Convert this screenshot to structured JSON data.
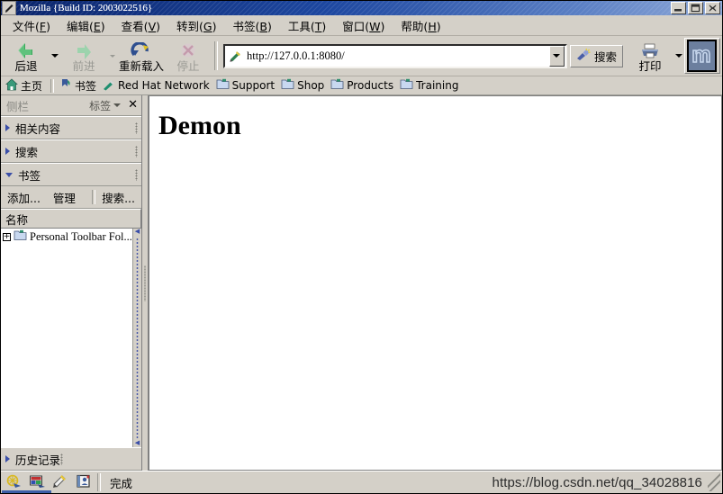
{
  "window": {
    "title": "Mozilla {Build ID: 2003022516}",
    "icon": "mozilla-window-icon",
    "controls": [
      {
        "name": "minimize-button",
        "glyph": "minimize-icon"
      },
      {
        "name": "maximize-button",
        "glyph": "maximize-icon"
      },
      {
        "name": "close-button",
        "glyph": "close-icon"
      }
    ]
  },
  "menubar": {
    "items": [
      {
        "label": "文件(F)",
        "text": "文件",
        "accel": "F"
      },
      {
        "label": "编辑(E)",
        "text": "编辑",
        "accel": "E"
      },
      {
        "label": "查看(V)",
        "text": "查看",
        "accel": "V"
      },
      {
        "label": "转到(G)",
        "text": "转到",
        "accel": "G"
      },
      {
        "label": "书签(B)",
        "text": "书签",
        "accel": "B"
      },
      {
        "label": "工具(T)",
        "text": "工具",
        "accel": "T"
      },
      {
        "label": "窗口(W)",
        "text": "窗口",
        "accel": "W"
      },
      {
        "label": "帮助(H)",
        "text": "帮助",
        "accel": "H"
      }
    ]
  },
  "toolbar": {
    "back_label": "后退",
    "forward_label": "前进",
    "reload_label": "重新载入",
    "stop_label": "停止",
    "search_label": "搜索",
    "print_label": "打印",
    "back_enabled": true,
    "forward_enabled": false,
    "stop_enabled": false,
    "logo": "mozilla-throbber-logo"
  },
  "urlbar": {
    "value": "http://127.0.0.1:8080/",
    "placeholder": "",
    "favicon": "mozilla-page-icon"
  },
  "bookmarks_bar": {
    "items": [
      {
        "label": "主页",
        "icon": "home-icon"
      },
      {
        "label": "书签",
        "icon": "bookmark-icon"
      },
      {
        "label": "Red Hat Network",
        "icon": "redhat-icon"
      },
      {
        "label": "Support",
        "icon": "folder-icon"
      },
      {
        "label": "Shop",
        "icon": "folder-icon"
      },
      {
        "label": "Products",
        "icon": "folder-icon"
      },
      {
        "label": "Training",
        "icon": "folder-icon"
      }
    ]
  },
  "sidebar": {
    "title": "侧栏",
    "tabs_label": "标签",
    "close_label": "✕",
    "panels": [
      {
        "label": "相关内容",
        "expanded": false
      },
      {
        "label": "搜索",
        "expanded": false
      },
      {
        "label": "书签",
        "expanded": true
      }
    ],
    "bookmark_tools": {
      "add_label": "添加...",
      "manage_label": "管理",
      "search_label": "搜索..."
    },
    "column_header": "名称",
    "tree_items": [
      {
        "label": "Personal Toolbar Fol...",
        "icon": "folder-icon",
        "expandable": true,
        "twisty": "+"
      }
    ],
    "footer_panel": {
      "label": "历史记录",
      "expanded": false
    }
  },
  "content": {
    "heading": "Demon"
  },
  "statusbar": {
    "icons": [
      {
        "name": "navigator-icon"
      },
      {
        "name": "composer-icon"
      },
      {
        "name": "mail-icon"
      },
      {
        "name": "addressbook-icon"
      }
    ],
    "message": "完成"
  },
  "watermark": {
    "text": "https://blog.csdn.net/qq_34028816"
  },
  "colors": {
    "chrome": "#d4d0c8",
    "title_start": "#0a246a",
    "title_end": "#8fa9d8",
    "accent": "#3e5fa8",
    "text": "#000000",
    "disabled_text": "#9a9a94",
    "content_bg": "#ffffff"
  }
}
